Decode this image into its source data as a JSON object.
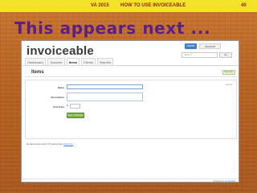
{
  "header": {
    "course": "VA 2015",
    "title": "HOW TO USE INVOICEABLE",
    "page_number": "40"
  },
  "slide": {
    "title": "This appears next ..."
  },
  "app": {
    "logo": "invoiceable",
    "account": {
      "primary": "Admin",
      "secondary": "Account"
    },
    "search": {
      "placeholder": "Search",
      "button": "Go"
    },
    "nav": [
      "Dashboard",
      "Invoices",
      "Items",
      "Clients",
      "Reports"
    ],
    "active_tab": "Items",
    "page_heading": "Items",
    "new_item_button": "New Item",
    "form": {
      "name_label": "Name",
      "description_label": "Description",
      "unit_price_label": "Unit Price",
      "currency": "$",
      "save_button": "Save Changes",
      "cancel_link": "Cancel"
    },
    "empty_message_prefix": "No items were found. To add an item ",
    "empty_message_link": "click here",
    "footer_prefix": "Powered by ",
    "footer_link": "Invoiceable"
  },
  "colors": {
    "header_bar": "#f3e22a",
    "header_text": "#8a2a1a",
    "slide_title": "#5a1f86",
    "background": "#b4601f",
    "save_button": "#7cb342",
    "link": "#3f7fc8"
  }
}
